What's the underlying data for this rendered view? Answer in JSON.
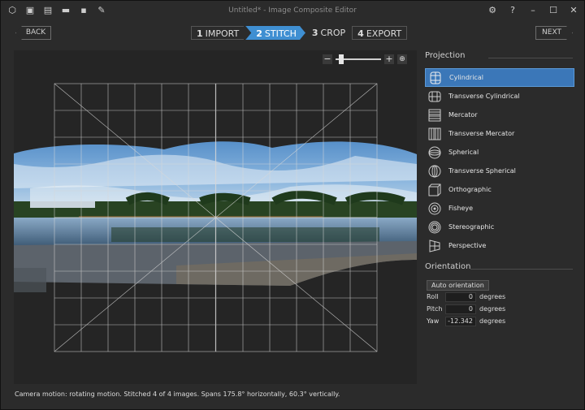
{
  "window": {
    "title": "Untitled* - Image Composite Editor",
    "toolbar_icons": [
      "new-project-icon",
      "new-panorama-icon",
      "new-video-icon",
      "open-icon",
      "save-icon",
      "publish-icon"
    ],
    "controls": [
      "settings-icon",
      "help-icon",
      "minimize-icon",
      "maximize-icon",
      "close-icon"
    ]
  },
  "nav": {
    "back_label": "BACK",
    "next_label": "NEXT",
    "steps": [
      {
        "num": "1",
        "label": "IMPORT"
      },
      {
        "num": "2",
        "label": "STITCH"
      },
      {
        "num": "3",
        "label": "CROP"
      },
      {
        "num": "4",
        "label": "EXPORT"
      }
    ],
    "active_step": 1
  },
  "zoom": {
    "minus": "−",
    "plus": "+",
    "level": 0.1
  },
  "status": "Camera motion: rotating motion. Stitched 4 of 4 images. Spans 175.8° horizontally, 60.3° vertically.",
  "projection": {
    "title": "Projection",
    "items": [
      {
        "label": "Cylindrical",
        "icon": "cylindrical-icon"
      },
      {
        "label": "Transverse Cylindrical",
        "icon": "transverse-cylindrical-icon"
      },
      {
        "label": "Mercator",
        "icon": "mercator-icon"
      },
      {
        "label": "Transverse Mercator",
        "icon": "transverse-mercator-icon"
      },
      {
        "label": "Spherical",
        "icon": "spherical-icon"
      },
      {
        "label": "Transverse Spherical",
        "icon": "transverse-spherical-icon"
      },
      {
        "label": "Orthographic",
        "icon": "orthographic-icon"
      },
      {
        "label": "Fisheye",
        "icon": "fisheye-icon"
      },
      {
        "label": "Stereographic",
        "icon": "stereographic-icon"
      },
      {
        "label": "Perspective",
        "icon": "perspective-icon"
      }
    ],
    "selected": 0
  },
  "orientation": {
    "title": "Orientation",
    "auto_label": "Auto orientation",
    "roll_label": "Roll",
    "roll_value": "0",
    "pitch_label": "Pitch",
    "pitch_value": "0",
    "yaw_label": "Yaw",
    "yaw_value": "-12.342",
    "unit": "degrees"
  },
  "colors": {
    "accent": "#3f8fd2",
    "selected": "#3b77b8"
  }
}
